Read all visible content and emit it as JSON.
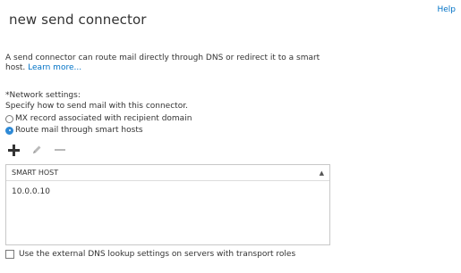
{
  "header": {
    "title": "new send connector",
    "help_label": "Help"
  },
  "description": {
    "text": "A send connector can route mail directly through DNS or redirect it to a smart host. ",
    "link_text": "Learn more..."
  },
  "network_settings": {
    "label": "*Network settings:",
    "help_text": "Specify how to send mail with this connector.",
    "options": [
      {
        "label": "MX record associated with recipient domain",
        "selected": false
      },
      {
        "label": "Route mail through smart hosts",
        "selected": true
      }
    ]
  },
  "toolbar": {
    "icons": [
      "add-icon",
      "edit-icon",
      "remove-icon"
    ]
  },
  "smart_hosts": {
    "column_header": "SMART HOST",
    "sort_indicator": "▲",
    "rows": [
      "10.0.0.10"
    ]
  },
  "dns_lookup": {
    "label": "Use the external DNS lookup settings on servers with transport roles",
    "checked": false
  },
  "colors": {
    "accent": "#0072c6",
    "radio_selected": "#2f8ad6",
    "text": "#333333"
  }
}
